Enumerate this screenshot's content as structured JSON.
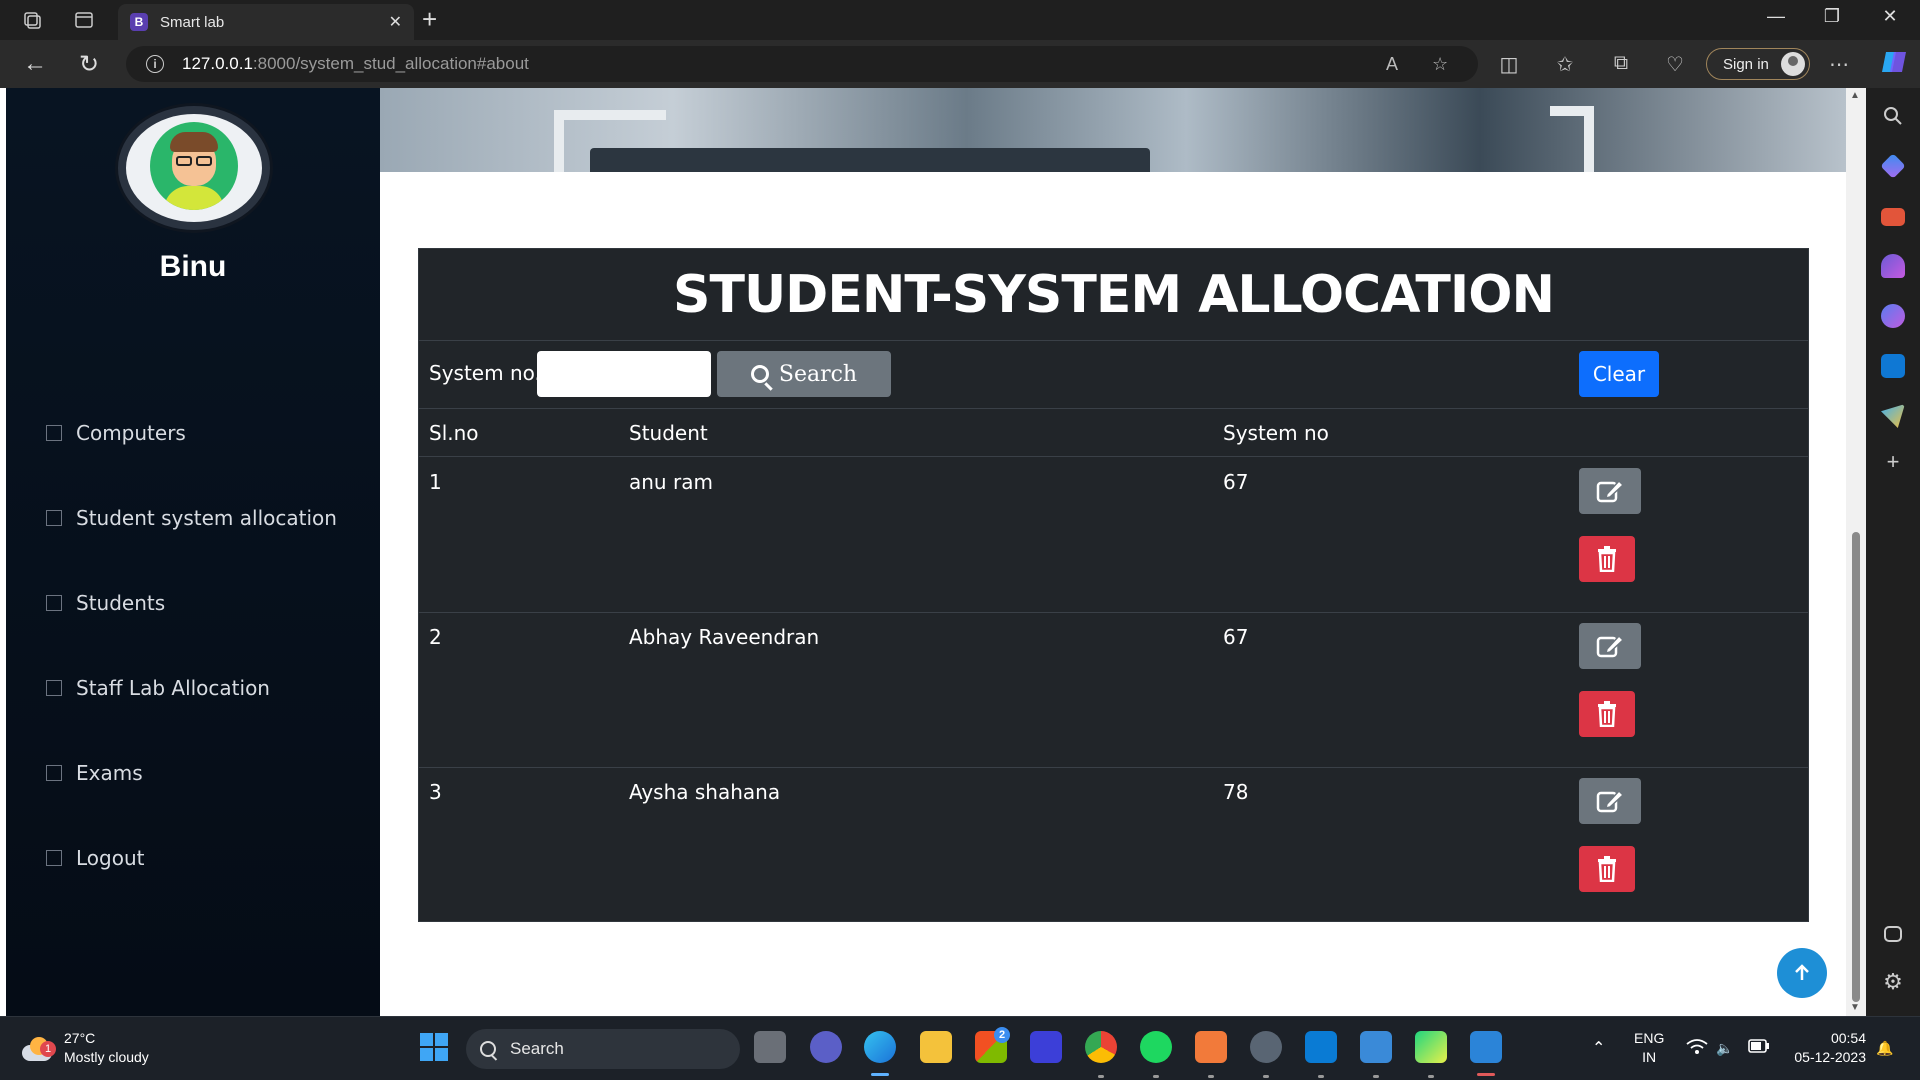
{
  "browser": {
    "tab_title": "Smart lab",
    "tab_favicon_letter": "B",
    "url_host": "127.0.0.1",
    "url_path": ":8000/system_stud_allocation#about",
    "sign_in_label": "Sign in"
  },
  "sidebar": {
    "username": "Binu",
    "items": [
      {
        "label": "Computers"
      },
      {
        "label": "Student system allocation"
      },
      {
        "label": "Students"
      },
      {
        "label": "Staff Lab Allocation"
      },
      {
        "label": "Exams"
      },
      {
        "label": "Logout"
      }
    ]
  },
  "main": {
    "title": "STUDENT-SYSTEM ALLOCATION",
    "search": {
      "label": "System no.",
      "input_value": "",
      "button_label": "Search",
      "clear_label": "Clear"
    },
    "table": {
      "headers": [
        "Sl.no",
        "Student",
        "System no"
      ],
      "rows": [
        {
          "slno": "1",
          "student": "anu ram",
          "system_no": "67"
        },
        {
          "slno": "2",
          "student": "Abhay Raveendran",
          "system_no": "67"
        },
        {
          "slno": "3",
          "student": "Aysha shahana",
          "system_no": "78"
        }
      ]
    }
  },
  "taskbar": {
    "weather_temp": "27°C",
    "weather_desc": "Mostly cloudy",
    "weather_badge": "1",
    "search_label": "Search",
    "store_badge": "2",
    "lang_top": "ENG",
    "lang_bottom": "IN",
    "time": "00:54",
    "date": "05-12-2023"
  },
  "colors": {
    "primary": "#0d6efd",
    "secondary": "#6c757d",
    "danger": "#dc3545",
    "table_bg": "#212529",
    "sidebar_bg": "#081422"
  }
}
